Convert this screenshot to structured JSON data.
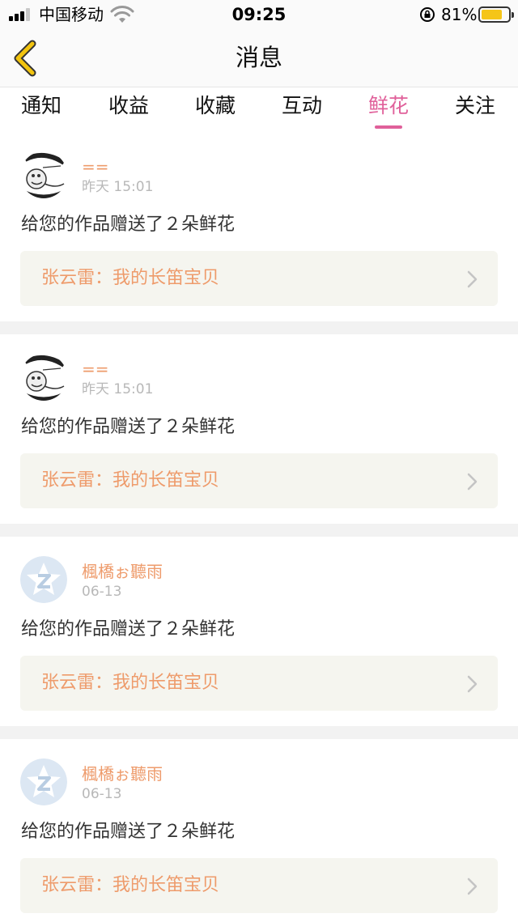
{
  "status_bar": {
    "carrier": "中国移动",
    "time": "09:25",
    "battery_percent_label": "81%",
    "battery_level": 0.81
  },
  "header": {
    "title": "消息",
    "back_icon": "chevron-left-icon"
  },
  "tabs": [
    {
      "label": "通知",
      "active": false
    },
    {
      "label": "收益",
      "active": false
    },
    {
      "label": "收藏",
      "active": false
    },
    {
      "label": "互动",
      "active": false
    },
    {
      "label": "鲜花",
      "active": true
    },
    {
      "label": "关注",
      "active": false
    }
  ],
  "colors": {
    "accent": "#e0609a",
    "username": "#ee9b6b",
    "work_link_bg": "#f5f5ef"
  },
  "messages": [
    {
      "username": "==",
      "time": "昨天 15:01",
      "text": "给您的作品赠送了２朵鲜花",
      "work_title": "张云雷：我的长笛宝贝",
      "avatar": "sketch-avatar"
    },
    {
      "username": "==",
      "time": "昨天 15:01",
      "text": "给您的作品赠送了２朵鲜花",
      "work_title": "张云雷：我的长笛宝贝",
      "avatar": "sketch-avatar"
    },
    {
      "username": "楓橋ぉ聽雨",
      "time": "06-13",
      "text": "给您的作品赠送了２朵鲜花",
      "work_title": "张云雷：我的长笛宝贝",
      "avatar": "default-star-avatar"
    },
    {
      "username": "楓橋ぉ聽雨",
      "time": "06-13",
      "text": "给您的作品赠送了２朵鲜花",
      "work_title": "张云雷：我的长笛宝贝",
      "avatar": "default-star-avatar"
    }
  ]
}
